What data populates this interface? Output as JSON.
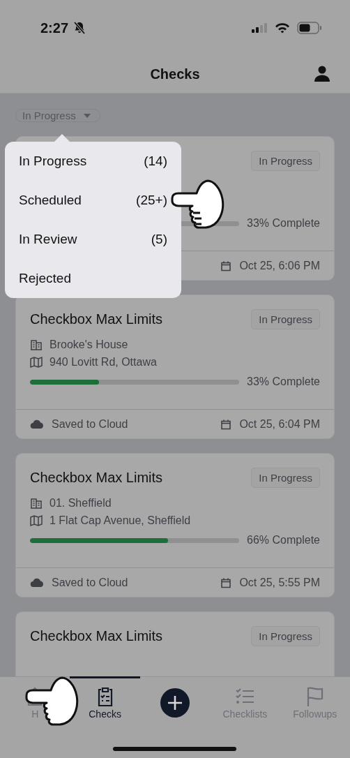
{
  "status_bar": {
    "time": "2:27"
  },
  "header": {
    "title": "Checks"
  },
  "filter": {
    "label": "In Progress"
  },
  "filter_menu": {
    "items": [
      {
        "label": "In Progress",
        "count": "(14)"
      },
      {
        "label": "Scheduled",
        "count": "(25+)"
      },
      {
        "label": "In Review",
        "count": "(5)"
      },
      {
        "label": "Rejected"
      }
    ]
  },
  "checks": [
    {
      "badge": "In Progress",
      "progress_text": "33% Complete",
      "date": "Oct 25, 6:06 PM"
    },
    {
      "title": "Checkbox Max Limits",
      "badge": "In Progress",
      "site": "Brooke's House",
      "address": "940 Lovitt Rd, Ottawa",
      "level": 0.33,
      "progress_text": "33% Complete",
      "save_status": "Saved to Cloud",
      "date": "Oct 25, 6:04 PM"
    },
    {
      "title": "Checkbox Max Limits",
      "badge": "In Progress",
      "site": "01. Sheffield",
      "address": "1 Flat Cap Avenue, Sheffield",
      "level": 0.66,
      "progress_text": "66% Complete",
      "save_status": "Saved to Cloud",
      "date": "Oct 25, 5:55 PM"
    },
    {
      "title": "Checkbox Max Limits",
      "badge": "In Progress"
    }
  ],
  "tab_bar": {
    "items": [
      {
        "kind": "tab",
        "label": "H",
        "selected": false
      },
      {
        "kind": "tab",
        "label": "Checks",
        "selected": true
      },
      {
        "kind": "add"
      },
      {
        "kind": "tab",
        "label": "Checklists",
        "selected": false
      },
      {
        "kind": "tab",
        "label": "Followups",
        "selected": false
      }
    ]
  }
}
